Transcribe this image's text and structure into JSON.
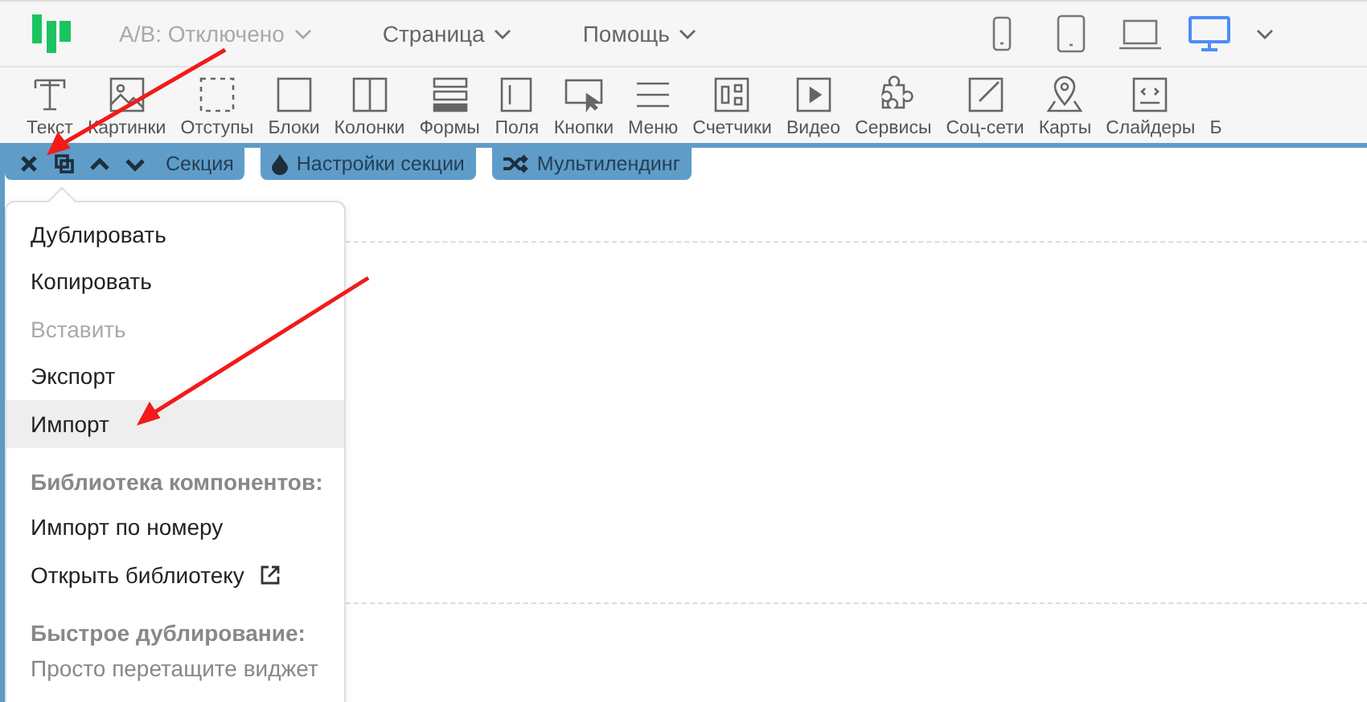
{
  "header": {
    "ab_test": {
      "label": "A/B: Отключено",
      "disabled": true
    },
    "menus": [
      "Страница",
      "Помощь"
    ],
    "devices": [
      {
        "kind": "phone",
        "selected": false
      },
      {
        "kind": "tablet",
        "selected": false
      },
      {
        "kind": "laptop",
        "selected": false
      },
      {
        "kind": "desktop",
        "selected": true
      }
    ]
  },
  "toolbar": [
    {
      "kind": "text",
      "label": "Текст"
    },
    {
      "kind": "image",
      "label": "Картинки"
    },
    {
      "kind": "spacing",
      "label": "Отступы"
    },
    {
      "kind": "block",
      "label": "Блоки"
    },
    {
      "kind": "columns",
      "label": "Колонки"
    },
    {
      "kind": "form",
      "label": "Формы"
    },
    {
      "kind": "field",
      "label": "Поля"
    },
    {
      "kind": "button",
      "label": "Кнопки"
    },
    {
      "kind": "menu",
      "label": "Меню"
    },
    {
      "kind": "counter",
      "label": "Счетчики"
    },
    {
      "kind": "video",
      "label": "Видео"
    },
    {
      "kind": "service",
      "label": "Сервисы"
    },
    {
      "kind": "social",
      "label": "Соц-сети"
    },
    {
      "kind": "map",
      "label": "Карты"
    },
    {
      "kind": "slider",
      "label": "Слайдеры"
    },
    {
      "kind": "none",
      "label": "Б"
    }
  ],
  "section_bar": {
    "label": "Секция",
    "tabs": [
      {
        "kind": "drop",
        "label": "Настройки секции"
      },
      {
        "kind": "shuffle",
        "label": "Мультилендинг"
      }
    ]
  },
  "context_menu": [
    {
      "kind": "item",
      "label": "Дублировать",
      "disabled": false,
      "selected": false
    },
    {
      "kind": "item",
      "label": "Копировать",
      "disabled": false,
      "selected": false
    },
    {
      "kind": "item",
      "label": "Вставить",
      "disabled": true,
      "selected": false
    },
    {
      "kind": "item",
      "label": "Экспорт",
      "disabled": false,
      "selected": false
    },
    {
      "kind": "item",
      "label": "Импорт",
      "disabled": false,
      "selected": true
    },
    {
      "kind": "heading",
      "label": "Библиотека компонентов:"
    },
    {
      "kind": "item",
      "label": "Импорт по номеру",
      "disabled": false,
      "selected": false
    },
    {
      "kind": "link",
      "label": "Открыть библиотеку",
      "disabled": false,
      "selected": false
    },
    {
      "kind": "heading",
      "label": "Быстрое дублирование:"
    },
    {
      "kind": "note",
      "label": "Просто перетащите виджет"
    }
  ]
}
